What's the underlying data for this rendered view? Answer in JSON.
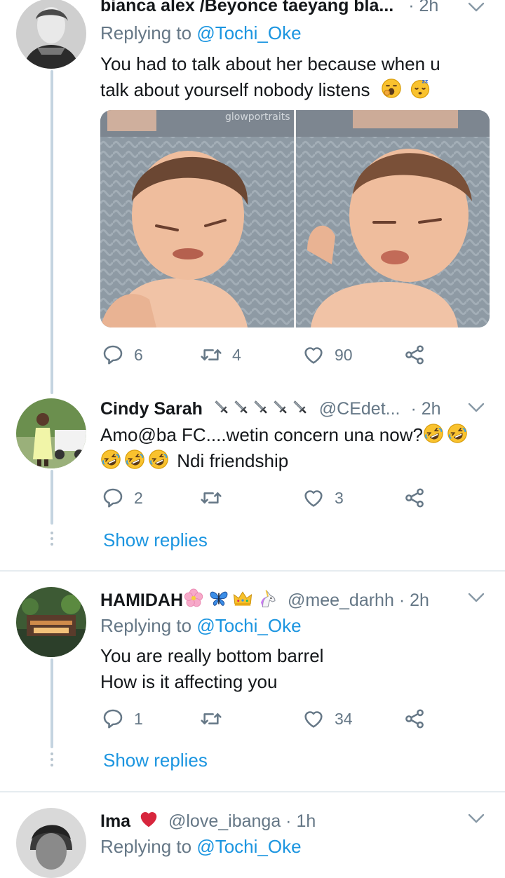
{
  "tweets": [
    {
      "name": "bianca alex /Beyonce taeyang bla...",
      "handle": "",
      "time": "· 2h",
      "replying_prefix": "Replying to ",
      "replying_to": "@Tochi_Oke",
      "text_lines": [
        "You had to talk about her because when u",
        "talk about yourself nobody listens"
      ],
      "emojis": [
        "yawning-face",
        "sleeping-face"
      ],
      "has_image": true,
      "image_watermark": "glowportraits",
      "replies": "6",
      "retweets": "4",
      "likes": "90"
    },
    {
      "name": "Cindy Sarah",
      "name_emojis": [
        "dagger",
        "dagger",
        "dagger",
        "dagger",
        "dagger"
      ],
      "handle": "@CEdet...",
      "time": "· 2h",
      "text_lines": [
        "Amo@ba FC....wetin concern una now?",
        "Ndi friendship"
      ],
      "replies": "2",
      "retweets": "",
      "likes": "3",
      "show_replies": "Show replies"
    },
    {
      "name": "HAMIDAH",
      "name_emojis": [
        "cherry-blossom",
        "butterfly",
        "crown",
        "unicorn"
      ],
      "handle": "@mee_darhh",
      "time": "· 2h",
      "replying_prefix": "Replying to ",
      "replying_to": "@Tochi_Oke",
      "text_lines": [
        "You are really bottom barrel",
        "How is it affecting you"
      ],
      "replies": "1",
      "retweets": "",
      "likes": "34",
      "show_replies": "Show replies"
    },
    {
      "name": "Ima",
      "name_emojis": [
        "red-heart"
      ],
      "handle": "@love_ibanga",
      "time": "· 1h",
      "replying_prefix": "Replying to ",
      "replying_to": "@Tochi_Oke"
    }
  ],
  "icons": {
    "reply": "reply-icon",
    "retweet": "retweet-icon",
    "like": "heart-icon",
    "share": "share-icon",
    "caret": "chevron-down-icon"
  },
  "colors": {
    "link": "#1b95e0",
    "muted": "#657786",
    "thread_line": "#c4d4e0",
    "divider": "#e6ecf0"
  }
}
